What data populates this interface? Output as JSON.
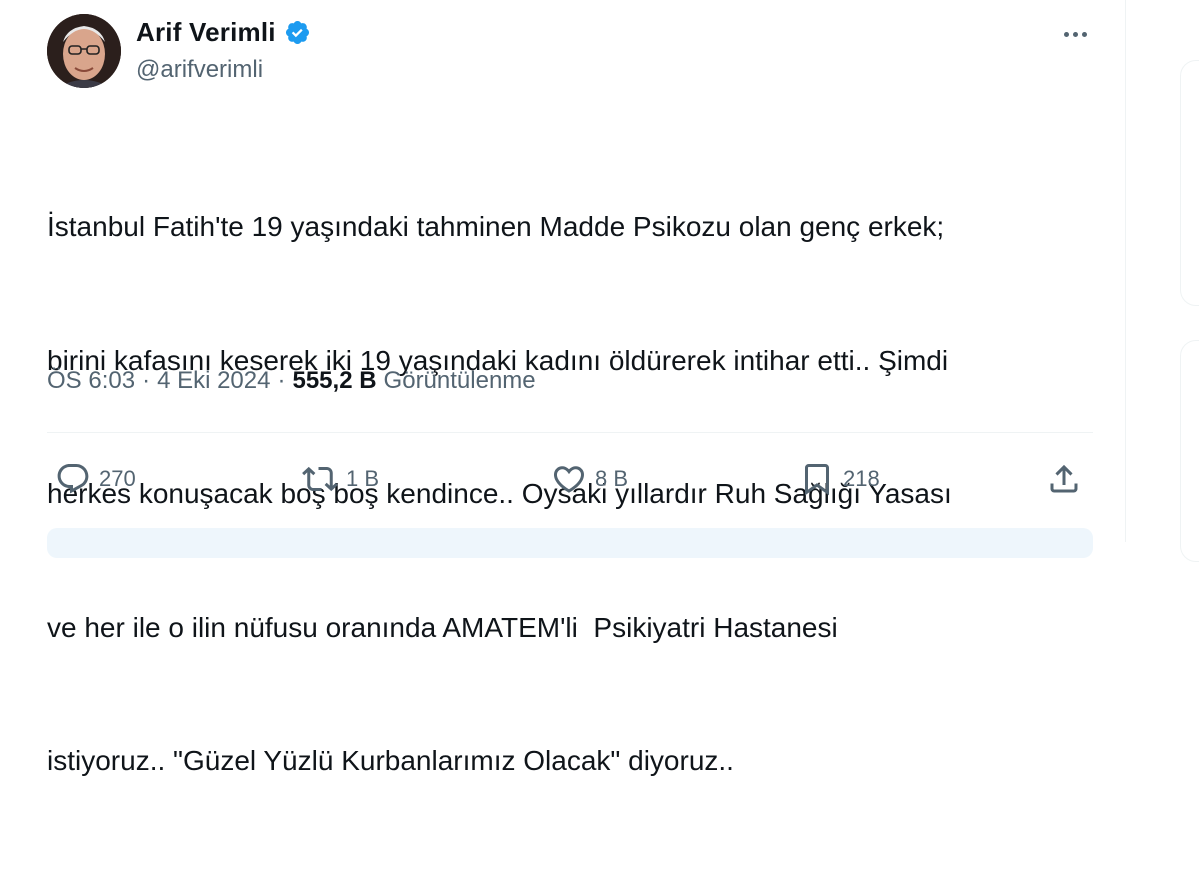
{
  "author": {
    "name": "Arif Verimli",
    "handle": "@arifverimli",
    "avatar_icon": "profile-photo",
    "verified_color": "#1d9bf0"
  },
  "tweet": {
    "text_lines": [
      "İstanbul Fatih'te 19 yaşındaki tahminen Madde Psikozu olan genç erkek;",
      "birini kafasını keserek iki 19 yaşındaki kadını öldürerek intihar etti.. Şimdi",
      "herkes konuşacak boş boş kendince.. Oysaki yıllardır Ruh Sağlığı Yasası",
      "ve her ile o ilin nüfusu oranında AMATEM'li  Psikiyatri Hastanesi",
      "istiyoruz.. \"Güzel Yüzlü Kurbanlarımız Olacak\" diyoruz.."
    ],
    "time": "ÖS 6:03",
    "date": "4 Eki 2024",
    "separator": "·",
    "views_count": "555,2 B",
    "views_label": "Görüntülenme"
  },
  "actions": {
    "replies": "270",
    "reposts": "1 B",
    "likes": "8 B",
    "bookmarks": "218"
  },
  "colors": {
    "text": "#0f1419",
    "secondary": "#536471",
    "accent": "#1d9bf0"
  }
}
